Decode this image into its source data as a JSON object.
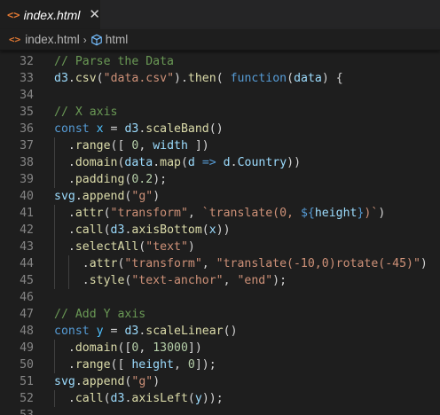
{
  "tab": {
    "icon": "html-file-icon",
    "icon_glyph": "<>",
    "label": "index.html",
    "close_glyph": "✕"
  },
  "breadcrumb": {
    "file": "index.html",
    "separator": "›",
    "symbol": "html"
  },
  "colors": {
    "background": "#1e1e1e",
    "tabbar": "#252526",
    "comment": "#6a9955",
    "variable": "#9cdcfe",
    "function": "#dcdcaa",
    "string": "#ce9178",
    "number": "#b5cea8",
    "keyword": "#569cd6",
    "constant": "#4fc1ff",
    "html_icon": "#e37933"
  },
  "lines": [
    {
      "n": "32",
      "indent": 0,
      "tokens": [
        [
          "c-comment",
          "// Parse the Data"
        ]
      ]
    },
    {
      "n": "33",
      "indent": 0,
      "tokens": [
        [
          "c-var",
          "d3"
        ],
        [
          "c-plain",
          "."
        ],
        [
          "c-func",
          "csv"
        ],
        [
          "c-plain",
          "("
        ],
        [
          "c-str",
          "\"data.csv\""
        ],
        [
          "c-plain",
          ")."
        ],
        [
          "c-func",
          "then"
        ],
        [
          "c-plain",
          "( "
        ],
        [
          "c-kw",
          "function"
        ],
        [
          "c-plain",
          "("
        ],
        [
          "c-var",
          "data"
        ],
        [
          "c-plain",
          ") {"
        ]
      ]
    },
    {
      "n": "34",
      "indent": 0,
      "tokens": []
    },
    {
      "n": "35",
      "indent": 0,
      "tokens": [
        [
          "c-comment",
          "// X axis"
        ]
      ]
    },
    {
      "n": "36",
      "indent": 0,
      "tokens": [
        [
          "c-kw",
          "const"
        ],
        [
          "c-plain",
          " "
        ],
        [
          "c-const",
          "x"
        ],
        [
          "c-plain",
          " = "
        ],
        [
          "c-var",
          "d3"
        ],
        [
          "c-plain",
          "."
        ],
        [
          "c-func",
          "scaleBand"
        ],
        [
          "c-plain",
          "()"
        ]
      ]
    },
    {
      "n": "37",
      "indent": 1,
      "tokens": [
        [
          "c-plain",
          "  ."
        ],
        [
          "c-func",
          "range"
        ],
        [
          "c-plain",
          "([ "
        ],
        [
          "c-num",
          "0"
        ],
        [
          "c-plain",
          ", "
        ],
        [
          "c-var",
          "width"
        ],
        [
          "c-plain",
          " ])"
        ]
      ]
    },
    {
      "n": "38",
      "indent": 1,
      "tokens": [
        [
          "c-plain",
          "  ."
        ],
        [
          "c-func",
          "domain"
        ],
        [
          "c-plain",
          "("
        ],
        [
          "c-var",
          "data"
        ],
        [
          "c-plain",
          "."
        ],
        [
          "c-func",
          "map"
        ],
        [
          "c-plain",
          "("
        ],
        [
          "c-var",
          "d"
        ],
        [
          "c-plain",
          " "
        ],
        [
          "c-kw",
          "=>"
        ],
        [
          "c-plain",
          " "
        ],
        [
          "c-var",
          "d"
        ],
        [
          "c-plain",
          "."
        ],
        [
          "c-var",
          "Country"
        ],
        [
          "c-plain",
          "))"
        ]
      ]
    },
    {
      "n": "39",
      "indent": 1,
      "tokens": [
        [
          "c-plain",
          "  ."
        ],
        [
          "c-func",
          "padding"
        ],
        [
          "c-plain",
          "("
        ],
        [
          "c-num",
          "0.2"
        ],
        [
          "c-plain",
          ");"
        ]
      ]
    },
    {
      "n": "40",
      "indent": 0,
      "tokens": [
        [
          "c-var",
          "svg"
        ],
        [
          "c-plain",
          "."
        ],
        [
          "c-func",
          "append"
        ],
        [
          "c-plain",
          "("
        ],
        [
          "c-str",
          "\"g\""
        ],
        [
          "c-plain",
          ")"
        ]
      ]
    },
    {
      "n": "41",
      "indent": 1,
      "tokens": [
        [
          "c-plain",
          "  ."
        ],
        [
          "c-func",
          "attr"
        ],
        [
          "c-plain",
          "("
        ],
        [
          "c-str",
          "\"transform\""
        ],
        [
          "c-plain",
          ", "
        ],
        [
          "c-str",
          "`translate(0, "
        ],
        [
          "c-kw",
          "${"
        ],
        [
          "c-var",
          "height"
        ],
        [
          "c-kw",
          "}"
        ],
        [
          "c-str",
          ")`"
        ],
        [
          "c-plain",
          ")"
        ]
      ]
    },
    {
      "n": "42",
      "indent": 1,
      "tokens": [
        [
          "c-plain",
          "  ."
        ],
        [
          "c-func",
          "call"
        ],
        [
          "c-plain",
          "("
        ],
        [
          "c-var",
          "d3"
        ],
        [
          "c-plain",
          "."
        ],
        [
          "c-func",
          "axisBottom"
        ],
        [
          "c-plain",
          "("
        ],
        [
          "c-var",
          "x"
        ],
        [
          "c-plain",
          "))"
        ]
      ]
    },
    {
      "n": "43",
      "indent": 1,
      "tokens": [
        [
          "c-plain",
          "  ."
        ],
        [
          "c-func",
          "selectAll"
        ],
        [
          "c-plain",
          "("
        ],
        [
          "c-str",
          "\"text\""
        ],
        [
          "c-plain",
          ")"
        ]
      ]
    },
    {
      "n": "44",
      "indent": 2,
      "tokens": [
        [
          "c-plain",
          "    ."
        ],
        [
          "c-func",
          "attr"
        ],
        [
          "c-plain",
          "("
        ],
        [
          "c-str",
          "\"transform\""
        ],
        [
          "c-plain",
          ", "
        ],
        [
          "c-str",
          "\"translate(-10,0)rotate(-45)\""
        ],
        [
          "c-plain",
          ")"
        ]
      ]
    },
    {
      "n": "45",
      "indent": 2,
      "tokens": [
        [
          "c-plain",
          "    ."
        ],
        [
          "c-func",
          "style"
        ],
        [
          "c-plain",
          "("
        ],
        [
          "c-str",
          "\"text-anchor\""
        ],
        [
          "c-plain",
          ", "
        ],
        [
          "c-str",
          "\"end\""
        ],
        [
          "c-plain",
          ");"
        ]
      ]
    },
    {
      "n": "46",
      "indent": 0,
      "tokens": []
    },
    {
      "n": "47",
      "indent": 0,
      "tokens": [
        [
          "c-comment",
          "// Add Y axis"
        ]
      ]
    },
    {
      "n": "48",
      "indent": 0,
      "tokens": [
        [
          "c-kw",
          "const"
        ],
        [
          "c-plain",
          " "
        ],
        [
          "c-const",
          "y"
        ],
        [
          "c-plain",
          " = "
        ],
        [
          "c-var",
          "d3"
        ],
        [
          "c-plain",
          "."
        ],
        [
          "c-func",
          "scaleLinear"
        ],
        [
          "c-plain",
          "()"
        ]
      ]
    },
    {
      "n": "49",
      "indent": 1,
      "tokens": [
        [
          "c-plain",
          "  ."
        ],
        [
          "c-func",
          "domain"
        ],
        [
          "c-plain",
          "(["
        ],
        [
          "c-num",
          "0"
        ],
        [
          "c-plain",
          ", "
        ],
        [
          "c-num",
          "13000"
        ],
        [
          "c-plain",
          "])"
        ]
      ]
    },
    {
      "n": "50",
      "indent": 1,
      "tokens": [
        [
          "c-plain",
          "  ."
        ],
        [
          "c-func",
          "range"
        ],
        [
          "c-plain",
          "([ "
        ],
        [
          "c-var",
          "height"
        ],
        [
          "c-plain",
          ", "
        ],
        [
          "c-num",
          "0"
        ],
        [
          "c-plain",
          "]);"
        ]
      ]
    },
    {
      "n": "51",
      "indent": 0,
      "tokens": [
        [
          "c-var",
          "svg"
        ],
        [
          "c-plain",
          "."
        ],
        [
          "c-func",
          "append"
        ],
        [
          "c-plain",
          "("
        ],
        [
          "c-str",
          "\"g\""
        ],
        [
          "c-plain",
          ")"
        ]
      ]
    },
    {
      "n": "52",
      "indent": 1,
      "tokens": [
        [
          "c-plain",
          "  ."
        ],
        [
          "c-func",
          "call"
        ],
        [
          "c-plain",
          "("
        ],
        [
          "c-var",
          "d3"
        ],
        [
          "c-plain",
          "."
        ],
        [
          "c-func",
          "axisLeft"
        ],
        [
          "c-plain",
          "("
        ],
        [
          "c-var",
          "y"
        ],
        [
          "c-plain",
          "));"
        ]
      ]
    },
    {
      "n": "53",
      "indent": 0,
      "tokens": []
    }
  ]
}
